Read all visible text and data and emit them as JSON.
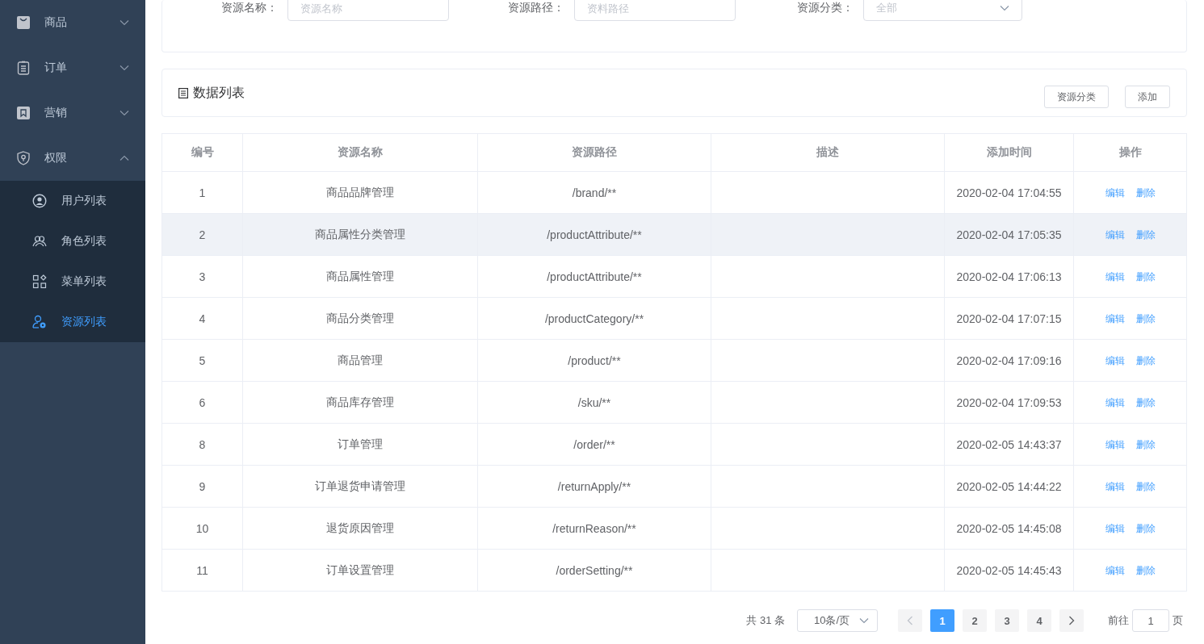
{
  "sidebar": {
    "items": [
      {
        "label": "商品",
        "expanded": false
      },
      {
        "label": "订单",
        "expanded": false
      },
      {
        "label": "营销",
        "expanded": false
      },
      {
        "label": "权限",
        "expanded": true,
        "children": [
          {
            "label": "用户列表",
            "selected": false
          },
          {
            "label": "角色列表",
            "selected": false
          },
          {
            "label": "菜单列表",
            "selected": false
          },
          {
            "label": "资源列表",
            "selected": true
          }
        ]
      }
    ]
  },
  "filters": [
    {
      "label": "资源名称：",
      "placeholder": "资源名称",
      "kind": "input"
    },
    {
      "label": "资源路径：",
      "placeholder": "资料路径",
      "kind": "input"
    },
    {
      "label": "资源分类：",
      "placeholder": "全部",
      "kind": "select"
    }
  ],
  "list_header": {
    "title": "数据列表",
    "buttons": [
      "资源分类",
      "添加"
    ]
  },
  "table": {
    "columns": [
      "编号",
      "资源名称",
      "资源路径",
      "描述",
      "添加时间",
      "操作"
    ],
    "rows": [
      {
        "id": "1",
        "name": "商品品牌管理",
        "path": "/brand/**",
        "time": "2020-02-04 17:04:55",
        "actions": [
          "编辑",
          "删除"
        ],
        "highlighted": false
      },
      {
        "id": "2",
        "name": "商品属性分类管理",
        "path": "/productAttribute/**",
        "time": "2020-02-04 17:05:35",
        "actions": [
          "编辑",
          "删除"
        ],
        "highlighted": true
      },
      {
        "id": "3",
        "name": "商品属性管理",
        "path": "/productAttribute/**",
        "time": "2020-02-04 17:06:13",
        "actions": [
          "编辑",
          "删除"
        ],
        "highlighted": false
      },
      {
        "id": "4",
        "name": "商品分类管理",
        "path": "/productCategory/**",
        "time": "2020-02-04 17:07:15",
        "actions": [
          "编辑",
          "删除"
        ],
        "highlighted": false
      },
      {
        "id": "5",
        "name": "商品管理",
        "path": "/product/**",
        "time": "2020-02-04 17:09:16",
        "actions": [
          "编辑",
          "删除"
        ],
        "highlighted": false
      },
      {
        "id": "6",
        "name": "商品库存管理",
        "path": "/sku/**",
        "time": "2020-02-04 17:09:53",
        "actions": [
          "编辑",
          "删除"
        ],
        "highlighted": false
      },
      {
        "id": "8",
        "name": "订单管理",
        "path": "/order/**",
        "time": "2020-02-05 14:43:37",
        "actions": [
          "编辑",
          "删除"
        ],
        "highlighted": false
      },
      {
        "id": "9",
        "name": "订单退货申请管理",
        "path": "/returnApply/**",
        "time": "2020-02-05 14:44:22",
        "actions": [
          "编辑",
          "删除"
        ],
        "highlighted": false
      },
      {
        "id": "10",
        "name": "退货原因管理",
        "path": "/returnReason/**",
        "time": "2020-02-05 14:45:08",
        "actions": [
          "编辑",
          "删除"
        ],
        "highlighted": false
      },
      {
        "id": "11",
        "name": "订单设置管理",
        "path": "/orderSetting/**",
        "time": "2020-02-05 14:45:43",
        "actions": [
          "编辑",
          "删除"
        ],
        "highlighted": false
      }
    ]
  },
  "pagination": {
    "total": "共 31 条",
    "page_size": "10条/页",
    "prev_disabled": true,
    "next_disabled": false,
    "pages": [
      {
        "label": "1",
        "selected": true
      },
      {
        "label": "2",
        "selected": false
      },
      {
        "label": "3",
        "selected": false
      },
      {
        "label": "4",
        "selected": false
      }
    ],
    "goto_label": "前往",
    "goto_value": "1",
    "goto_suffix": "页"
  }
}
